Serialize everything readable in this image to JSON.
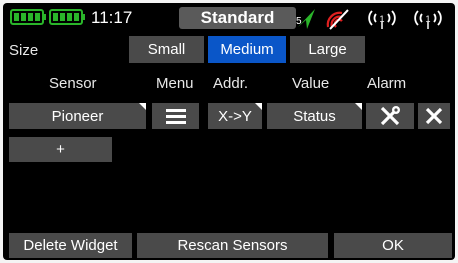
{
  "statusbar": {
    "time": "11:17",
    "title": "Standard",
    "signal_number": "5"
  },
  "size": {
    "label": "Size",
    "options": [
      "Small",
      "Medium",
      "Large"
    ],
    "selected": "Medium"
  },
  "table": {
    "headers": [
      "Sensor",
      "Menu",
      "Addr.",
      "Value",
      "Alarm"
    ],
    "row": {
      "sensor": "Pioneer",
      "addr": "X->Y",
      "value": "Status"
    },
    "add_label": "+"
  },
  "footer": {
    "delete_label": "Delete Widget",
    "rescan_label": "Rescan Sensors",
    "ok_label": "OK"
  },
  "colors": {
    "accent": "#0a56c8",
    "battery": "#2ab52a",
    "button": "#4a4a4a",
    "alert": "#e02020"
  },
  "icons": [
    "battery-icon",
    "battery-icon",
    "signal-strength-icon",
    "no-signal-icon",
    "antenna-icon",
    "antenna-icon",
    "menu-icon",
    "tools-icon",
    "close-icon"
  ]
}
